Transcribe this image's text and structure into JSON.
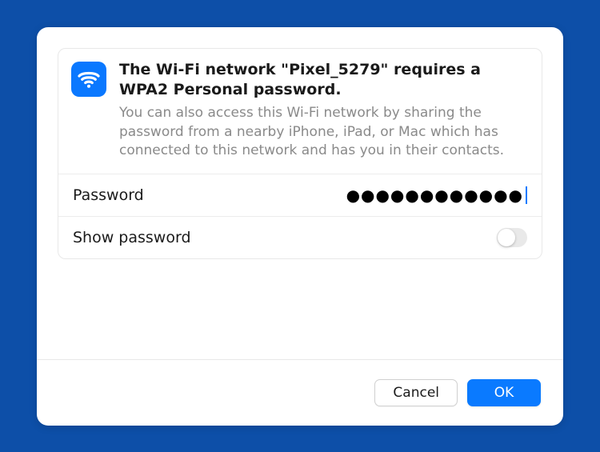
{
  "dialog": {
    "title": "The Wi-Fi network \"Pixel_5279\" requires a WPA2 Personal password.",
    "subtitle": "You can also access this Wi-Fi network by sharing the password from a nearby iPhone, iPad, or Mac which has connected to this network and has you in their contacts.",
    "password_label": "Password",
    "password_value": "●●●●●●●●●●●●",
    "show_password_label": "Show password"
  },
  "buttons": {
    "cancel": "Cancel",
    "ok": "OK"
  }
}
